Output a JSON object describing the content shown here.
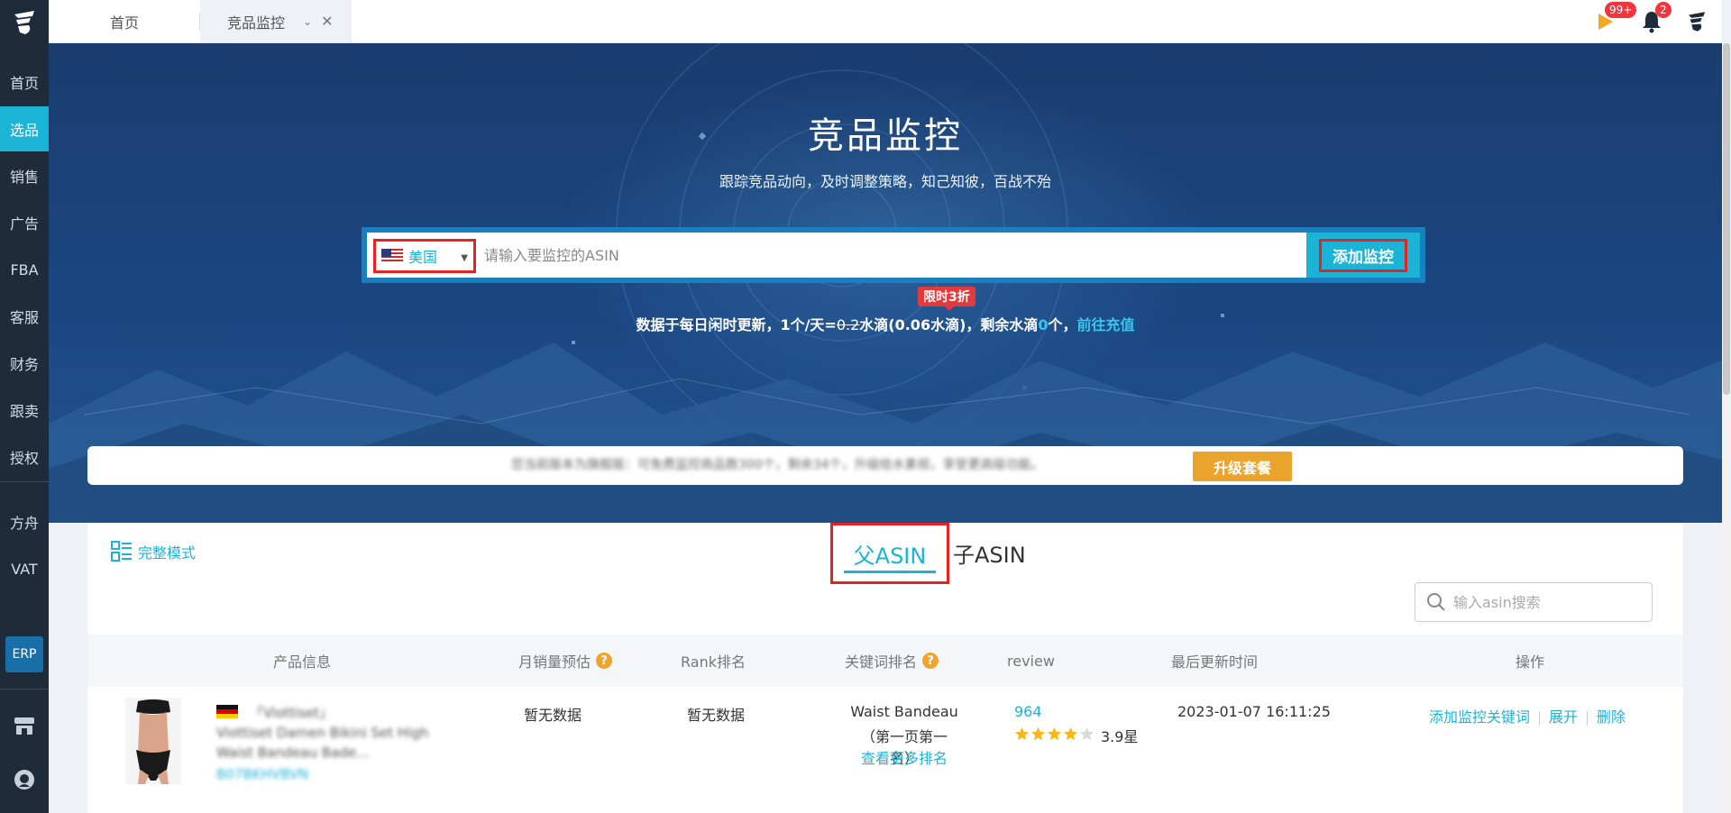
{
  "sidebar": {
    "items": [
      {
        "label": "首页"
      },
      {
        "label": "选品"
      },
      {
        "label": "销售"
      },
      {
        "label": "广告"
      },
      {
        "label": "FBA"
      },
      {
        "label": "客服"
      },
      {
        "label": "财务"
      },
      {
        "label": "跟卖"
      },
      {
        "label": "授权"
      },
      {
        "label": "方舟"
      },
      {
        "label": "VAT"
      }
    ],
    "active_index": 1,
    "erp_label": "ERP"
  },
  "topbar": {
    "tabs": [
      {
        "label": "首页"
      },
      {
        "label": "竞品监控"
      }
    ],
    "flag_badge": "99+",
    "bell_badge": "2"
  },
  "hero": {
    "title": "竞品监控",
    "subtitle": "跟踪竞品动向，及时调整策略，知己知彼，百战不殆",
    "country": "美国",
    "input_placeholder": "请输入要监控的ASIN",
    "add_button": "添加监控",
    "promo_tag": "限时3折",
    "info_prefix": "数据于每日闲时更新，1个/天=",
    "info_old_price": "0.2",
    "info_mid": "水滴(0.06水滴)，剩余水滴",
    "info_remaining": "0",
    "info_suffix": "个，",
    "info_link": "前往充值"
  },
  "upgrade": {
    "text": "您当前版本为旗舰版：可免费监控商品数300个，剩余34个，升级给水素视，享受更高级功能。",
    "button": "升级套餐"
  },
  "panel": {
    "mode_label": "完整模式",
    "tab_parent": "父ASIN",
    "tab_child": "子ASIN",
    "search_placeholder": "输入asin搜索",
    "columns": [
      "产品信息",
      "月销量预估",
      "Rank排名",
      "关键词排名",
      "review",
      "最后更新时间",
      "操作"
    ],
    "rows": [
      {
        "brand": "「Viottiset」",
        "title_line1": "Viottiset Damen Bikini Set High",
        "title_line2": "Waist Bandeau Bade...",
        "asin": "B07BKHVBVN",
        "monthly_sales": "暂无数据",
        "rank": "暂无数据",
        "keyword": "Waist Bandeau",
        "keyword_rank": "（第一页第一名）",
        "keyword_more": "查看更多排名",
        "review_count": "964",
        "rating": 3.9,
        "rating_label": "3.9星",
        "updated": "2023-01-07 16:11:25",
        "op_add_keyword": "添加监控关键词",
        "op_expand": "展开",
        "op_delete": "删除"
      }
    ]
  },
  "colors": {
    "accent": "#1cb4d6",
    "sidebar_bg": "#1d2b3a",
    "highlight_border": "#e42424",
    "upgrade_button": "#eaa42c"
  }
}
